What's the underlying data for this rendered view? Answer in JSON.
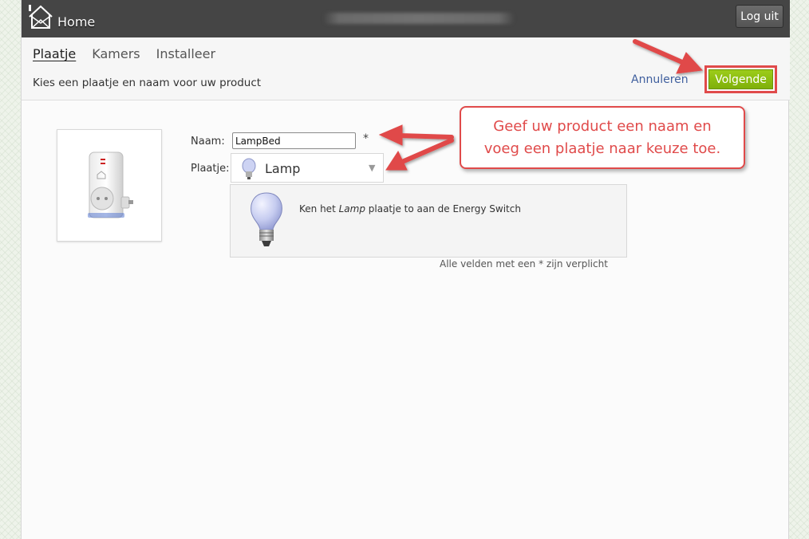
{
  "topbar": {
    "home_label": "Home",
    "logout_label": "Log uit"
  },
  "tabs": [
    {
      "label": "Plaatje",
      "active": true
    },
    {
      "label": "Kamers",
      "active": false
    },
    {
      "label": "Installeer",
      "active": false
    }
  ],
  "subheader": {
    "subtitle": "Kies een plaatje en naam voor uw product",
    "cancel_label": "Annuleren",
    "next_label": "Volgende"
  },
  "form": {
    "name_label": "Naam:",
    "name_value": "LampBed",
    "required_star": "*",
    "image_label": "Plaatje:",
    "image_value": "Lamp",
    "preview_prefix": "Ken het ",
    "preview_italic": "Lamp",
    "preview_suffix": " plaatje to aan de Energy Switch",
    "required_note": "Alle velden met een * zijn verplicht"
  },
  "callout": {
    "line1": "Geef uw product een naam en",
    "line2": "voeg een plaatje naar keuze toe."
  },
  "colors": {
    "topbar": "#454545",
    "accent_green": "#8dbf12",
    "annotation_red": "#e04a4a",
    "link_blue": "#3f5f9e"
  },
  "icons": {
    "home": "house-logo-icon",
    "plug": "energy-switch-plug-icon",
    "bulb": "light-bulb-icon",
    "dropdown": "triangle-down-icon"
  }
}
